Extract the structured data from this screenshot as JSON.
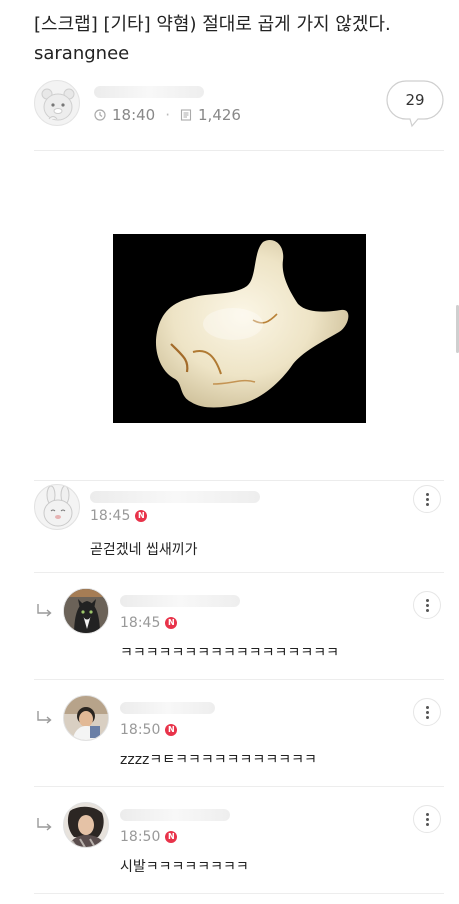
{
  "post": {
    "title": "[스크랩] [기타] 약혐) 절대로 곱게 가지 않겠다. sarangnee",
    "time": "18:40",
    "views": "1,426",
    "comment_count": "29"
  },
  "comments": [
    {
      "time": "18:45",
      "badge": "N",
      "text": "곧걷겠네 씹새끼가",
      "is_reply": false
    },
    {
      "time": "18:45",
      "badge": "N",
      "text": "ㅋㅋㅋㅋㅋㅋㅋㅋㅋㅋㅋㅋㅋㅋㅋㅋㅋ",
      "is_reply": true
    },
    {
      "time": "18:50",
      "badge": "N",
      "text": "zzzzㅋㅌㅋㅋㅋㅋㅋㅋㅋㅋㅋㅋㅋ",
      "is_reply": true
    },
    {
      "time": "18:50",
      "badge": "N",
      "text": "시발ㅋㅋㅋㅋㅋㅋㅋㅋ",
      "is_reply": true
    }
  ],
  "icons": {
    "clock": "clock-icon",
    "views": "document-icon",
    "more": "more-vertical-icon",
    "reply": "reply-arrow-icon"
  },
  "colors": {
    "badge": "#e8334a",
    "meta_text": "#888888"
  }
}
